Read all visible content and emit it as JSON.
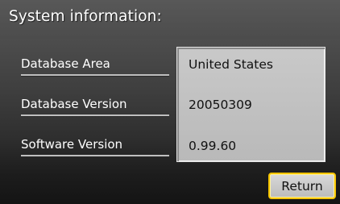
{
  "header": {
    "title": "System information:"
  },
  "fields": [
    {
      "label": "Database Area",
      "value": "United States"
    },
    {
      "label": "Database Version",
      "value": "20050309"
    },
    {
      "label": "Software Version",
      "value": "0.99.60"
    }
  ],
  "actions": {
    "return_label": "Return"
  },
  "colors": {
    "background": "#3f3f3f",
    "panel": "#c2c2c2",
    "highlight": "#f5c400"
  }
}
